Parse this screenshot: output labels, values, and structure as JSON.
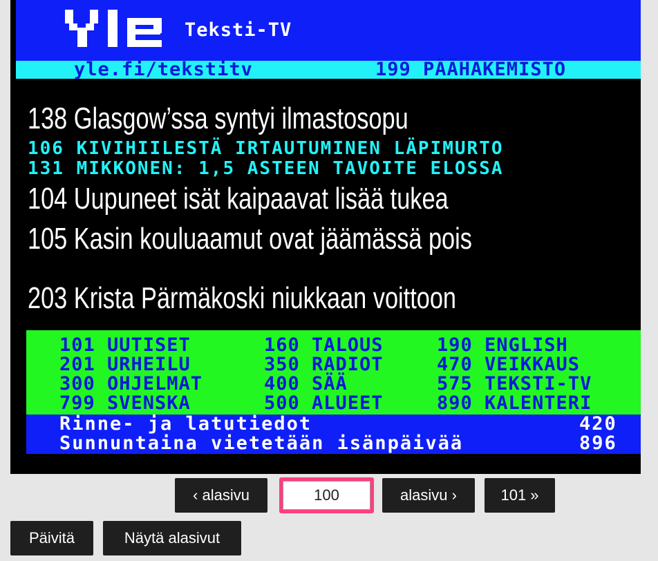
{
  "header": {
    "brand_sub": "Teksti-TV",
    "url": "yle.fi/tekstitv",
    "index_link": "199 PÄÄHAKEMISTO"
  },
  "colors": {
    "header_blue": "#0f1ff8",
    "cyan": "#22f2f8",
    "green": "#22f722",
    "highlight": "#ff3f7f",
    "button": "#1f1f1f"
  },
  "headlines": [
    {
      "text": "138 Glasgow’ssa syntyi ilmastosopu"
    },
    {
      "text": "106 KIVIHIILESTÄ IRTAUTUMINEN LÄPIMURTO"
    },
    {
      "text": "131 MIKKONEN: 1,5 ASTEEN TAVOITE ELOSSA"
    },
    {
      "text": "104 Uupuneet isät kaipaavat lisää tukea"
    },
    {
      "text": "105 Kasin kouluaamut ovat jäämässä pois"
    },
    {
      "text": "203 Krista Pärmäkoski niukkaan voittoon"
    }
  ],
  "nav": [
    [
      "101 UUTISET",
      "160 TALOUS",
      "190 ENGLISH"
    ],
    [
      "201 URHEILU",
      "350 RADIOT",
      "470 VEIKKAUS"
    ],
    [
      "300 OHJELMAT",
      "400 SÄÄ",
      "575 TEKSTI-TV"
    ],
    [
      "799 SVENSKA",
      "500 ALUEET",
      "890 KALENTERI"
    ]
  ],
  "promos": [
    {
      "text": "Rinne- ja latutiedot",
      "page": "420"
    },
    {
      "text": "Sunnuntaina vietetään isänpäivää",
      "page": "896"
    }
  ],
  "controls": {
    "prev_subpage": "‹ alasivu",
    "page_value": "100",
    "next_subpage": "alasivu ›",
    "next_page": "101 »",
    "refresh": "Päivitä",
    "show_subpages": "Näytä alasivut"
  }
}
